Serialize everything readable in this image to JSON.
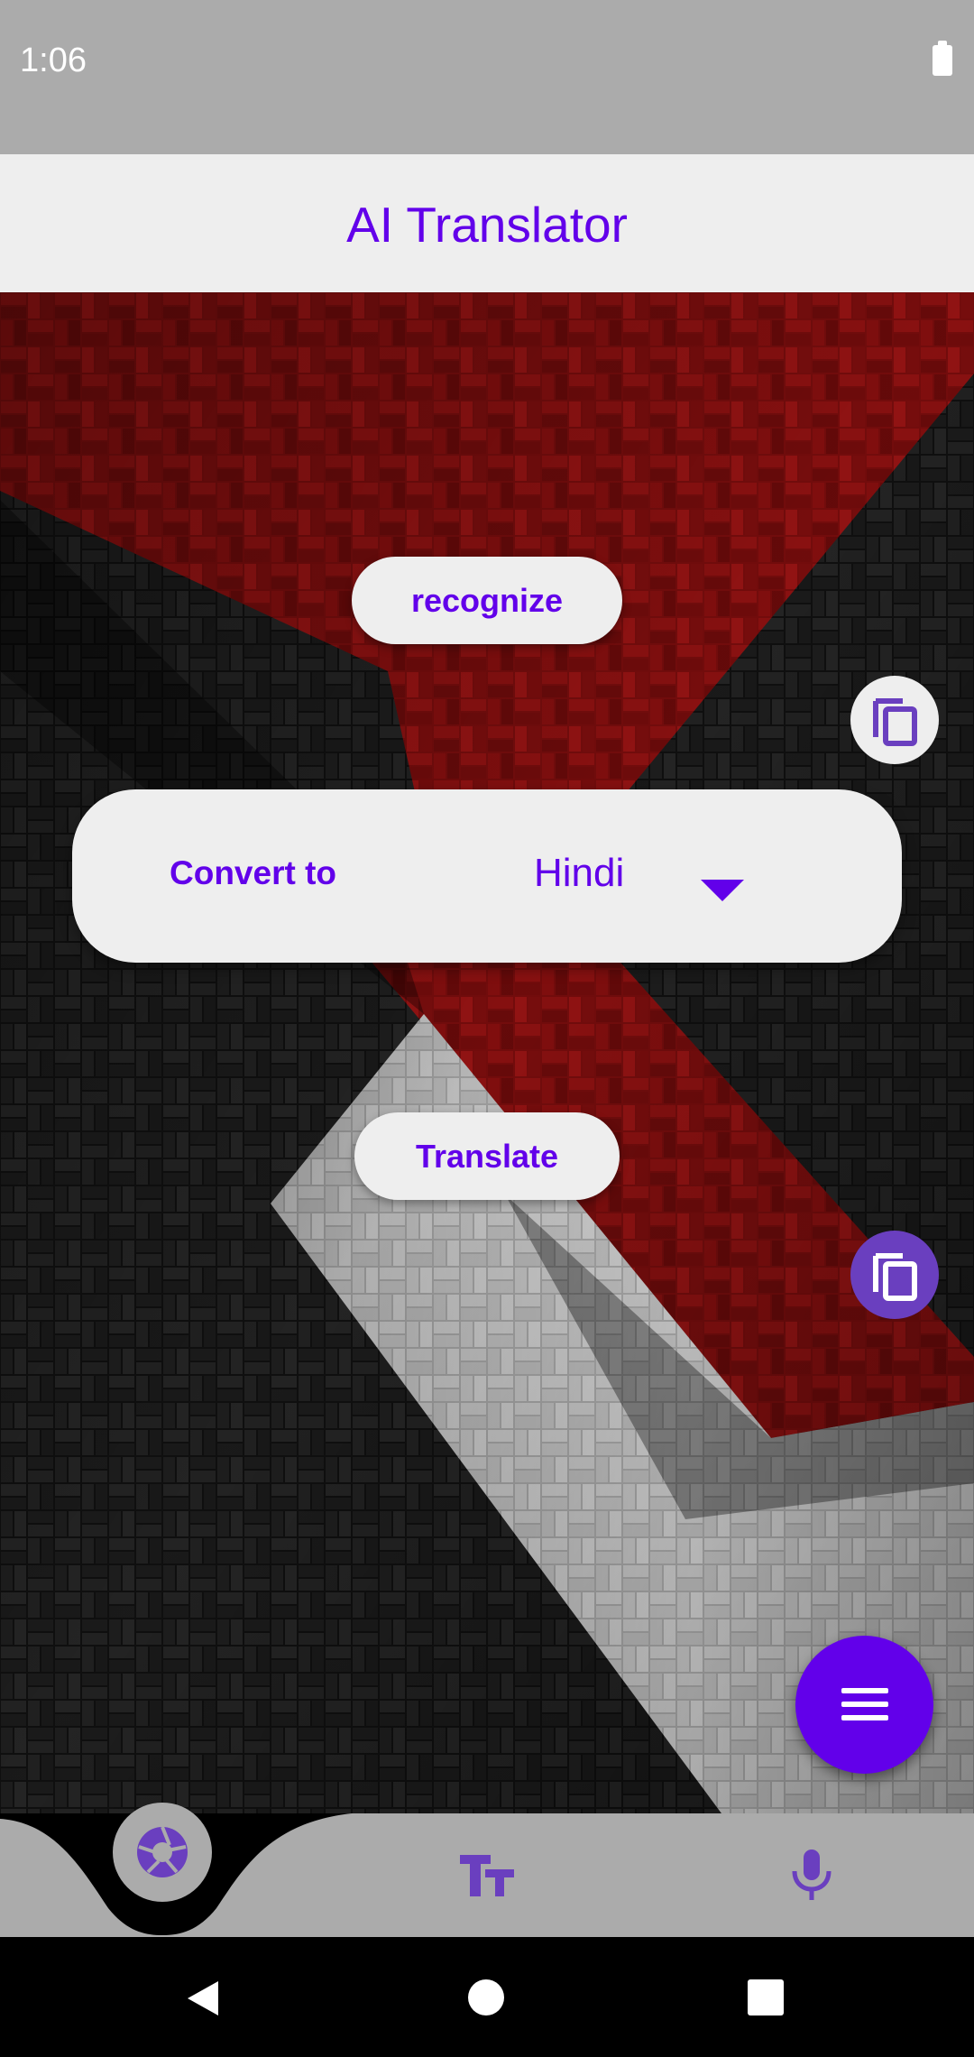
{
  "status_bar": {
    "time": "1:06"
  },
  "app_bar": {
    "title": "AI Translator"
  },
  "main": {
    "recognize_label": "recognize",
    "convert_label": "Convert to",
    "language": "Hindi",
    "translate_label": "Translate"
  },
  "icons": {
    "copy_top": "copy-icon",
    "copy_bottom": "copy-icon",
    "fab": "menu-icon",
    "camera": "camera-shutter-icon",
    "text": "text-size-icon",
    "mic": "microphone-icon"
  },
  "colors": {
    "accent": "#6200ea",
    "app_bar_bg": "#eeeeee",
    "status_bar_bg": "#ababab",
    "bottom_nav_bg": "#ababab",
    "copy_bottom_bg": "#6a3fbf"
  }
}
